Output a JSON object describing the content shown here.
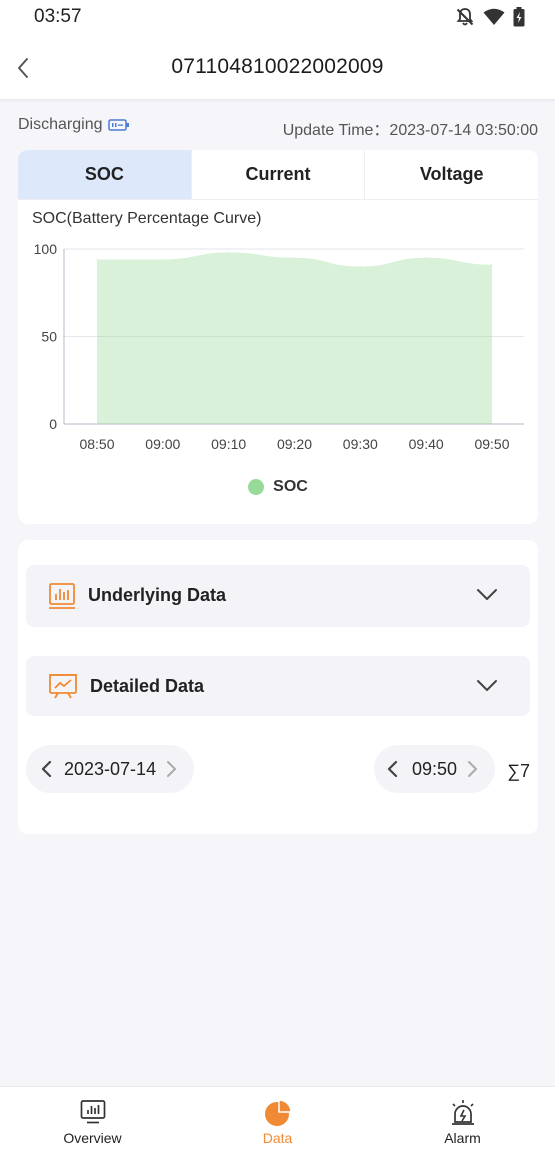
{
  "status_bar": {
    "time": "03:57"
  },
  "header": {
    "title": "071104810022002009"
  },
  "info": {
    "status": "Discharging",
    "update_label": "Update Time：",
    "update_time": "2023-07-14 03:50:00"
  },
  "tabs": [
    {
      "label": "SOC",
      "active": true
    },
    {
      "label": "Current",
      "active": false
    },
    {
      "label": "Voltage",
      "active": false
    }
  ],
  "chart_title": "SOC(Battery Percentage Curve)",
  "chart_data": {
    "type": "area",
    "x": [
      "08:50",
      "09:00",
      "09:10",
      "09:20",
      "09:30",
      "09:40",
      "09:50"
    ],
    "series": [
      {
        "name": "SOC",
        "color": "#98db98",
        "values": [
          94,
          94,
          98,
          95,
          90,
          95,
          91
        ]
      }
    ],
    "ylim": [
      0,
      100
    ],
    "yticks": [
      0,
      50,
      100
    ],
    "legend": "bottom-center",
    "grid": true
  },
  "panels": {
    "underlying": {
      "label": "Underlying Data"
    },
    "detailed": {
      "label": "Detailed Data"
    }
  },
  "date_picker": {
    "value": "2023-07-14"
  },
  "time_picker": {
    "value": "09:50"
  },
  "sum_label": "∑7",
  "nav": [
    {
      "label": "Overview",
      "icon": "overview-icon",
      "active": false
    },
    {
      "label": "Data",
      "icon": "data-pie-icon",
      "active": true
    },
    {
      "label": "Alarm",
      "icon": "alarm-icon",
      "active": false
    }
  ],
  "colors": {
    "accent": "#f08a34",
    "active_tab": "#dde8fb",
    "series": "#98db98"
  }
}
